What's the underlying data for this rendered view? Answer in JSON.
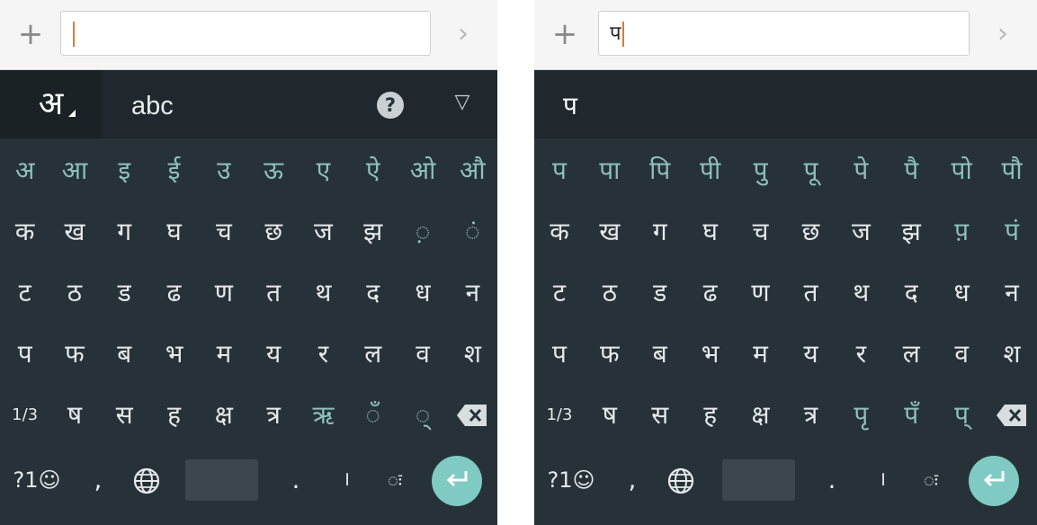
{
  "left": {
    "input_text": "",
    "lang_label": "अ",
    "abc_label": "abc",
    "help_label": "?",
    "collapse_label": "▽",
    "rows": [
      {
        "keys": [
          "अ",
          "आ",
          "इ",
          "ई",
          "उ",
          "ऊ",
          "ए",
          "ऐ",
          "ओ",
          "औ"
        ],
        "teal": [
          0,
          1,
          2,
          3,
          4,
          5,
          6,
          7,
          8,
          9
        ]
      },
      {
        "keys": [
          "क",
          "ख",
          "ग",
          "घ",
          "च",
          "छ",
          "ज",
          "झ",
          "◌़",
          "◌ं"
        ],
        "teal": [
          8,
          9
        ]
      },
      {
        "keys": [
          "ट",
          "ठ",
          "ड",
          "ढ",
          "ण",
          "त",
          "थ",
          "द",
          "ध",
          "न"
        ],
        "teal": []
      },
      {
        "keys": [
          "प",
          "फ",
          "ब",
          "भ",
          "म",
          "य",
          "र",
          "ल",
          "व",
          "श"
        ],
        "teal": []
      },
      {
        "keys": [
          "1/3",
          "ष",
          "स",
          "ह",
          "क्ष",
          "त्र",
          "ऋ",
          "◌ँ",
          "◌्"
        ],
        "teal": [
          6,
          7,
          8
        ]
      }
    ],
    "bottom": {
      "sym_label": "?1☺",
      "comma": ",",
      "period": ".",
      "danda": "।",
      "visarga": "◌ः"
    }
  },
  "right": {
    "input_text": "प",
    "suggestion": "प",
    "rows": [
      {
        "keys": [
          "प",
          "पा",
          "पि",
          "पी",
          "पु",
          "पू",
          "पे",
          "पै",
          "पो",
          "पौ"
        ],
        "teal": [
          0,
          1,
          2,
          3,
          4,
          5,
          6,
          7,
          8,
          9
        ]
      },
      {
        "keys": [
          "क",
          "ख",
          "ग",
          "घ",
          "च",
          "छ",
          "ज",
          "झ",
          "प़",
          "पं"
        ],
        "teal": [
          8,
          9
        ]
      },
      {
        "keys": [
          "ट",
          "ठ",
          "ड",
          "ढ",
          "ण",
          "त",
          "थ",
          "द",
          "ध",
          "न"
        ],
        "teal": []
      },
      {
        "keys": [
          "प",
          "फ",
          "ब",
          "भ",
          "म",
          "य",
          "र",
          "ल",
          "व",
          "श"
        ],
        "teal": []
      },
      {
        "keys": [
          "1/3",
          "ष",
          "स",
          "ह",
          "क्ष",
          "त्र",
          "पृ",
          "पँ",
          "प्"
        ],
        "teal": [
          6,
          7,
          8
        ]
      }
    ],
    "bottom": {
      "sym_label": "?1☺",
      "comma": ",",
      "period": ".",
      "danda": "।",
      "visarga": "◌ः"
    }
  },
  "icons": {
    "add": "plus-icon",
    "send": "chevron-right-icon",
    "backspace": "backspace-icon",
    "globe": "globe-icon",
    "enter": "enter-icon"
  },
  "colors": {
    "keyboard_bg": "#273238",
    "suggestion_bg": "#20282d",
    "key_text": "#e5e9eb",
    "accent_teal": "#8ec1bb",
    "enter_button": "#7fcac3",
    "caret": "#e07b2a"
  }
}
